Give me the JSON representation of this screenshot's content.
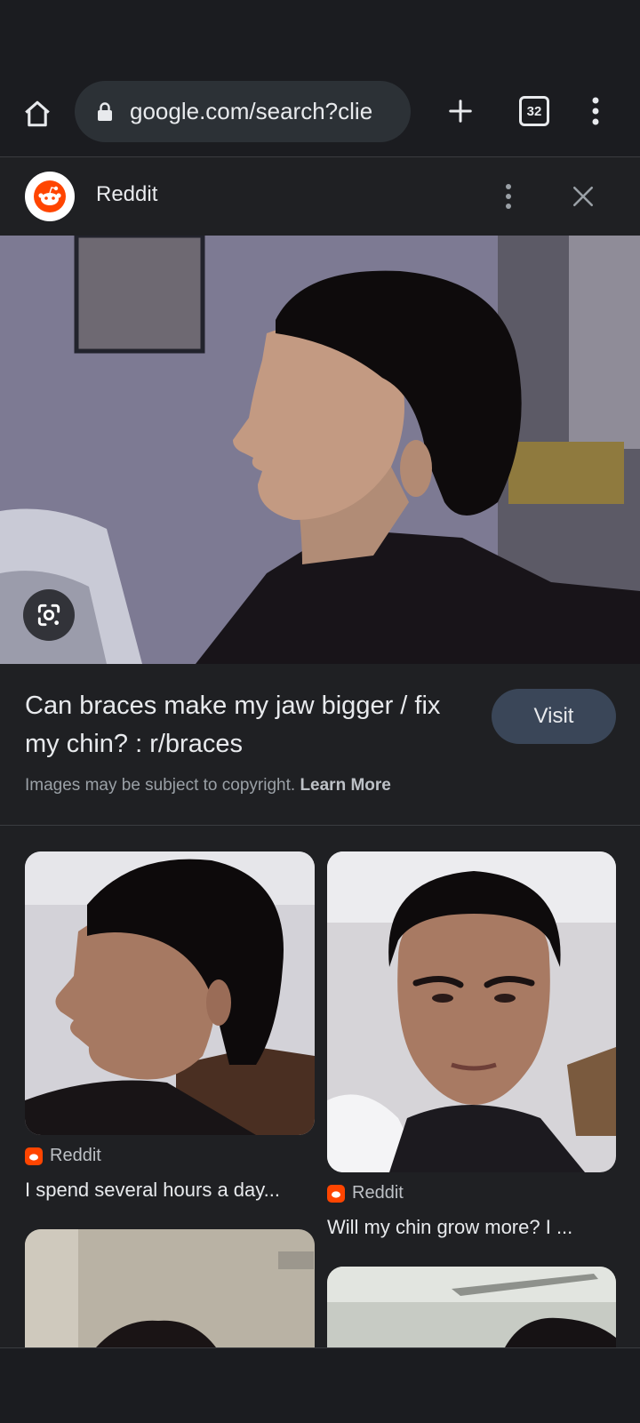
{
  "browser": {
    "url": "google.com/search?clie",
    "tab_count": "32",
    "icons": {
      "home": "home-icon",
      "lock": "lock-icon",
      "new_tab": "plus-icon",
      "tabs": "tab-switcher-icon",
      "menu": "more-vert-icon"
    }
  },
  "source": {
    "name": "Reddit",
    "favicon": "reddit-icon",
    "brand_color": "#ff4500"
  },
  "result": {
    "title": "Can braces make my jaw bigger / fix my chin? : r/braces",
    "visit_label": "Visit",
    "copyright_text": "Images may be subject to copyright.",
    "learn_more": "Learn More",
    "lens_icon": "google-lens-icon"
  },
  "related": [
    {
      "source": "Reddit",
      "caption": "I spend several hours a day..."
    },
    {
      "source": "Reddit",
      "caption": "Will my chin grow more? I ..."
    }
  ],
  "colors": {
    "background": "#1f2023",
    "toolbar": "#1b1c20",
    "url_bar": "#2c3136",
    "visit_button": "#3a4658"
  }
}
